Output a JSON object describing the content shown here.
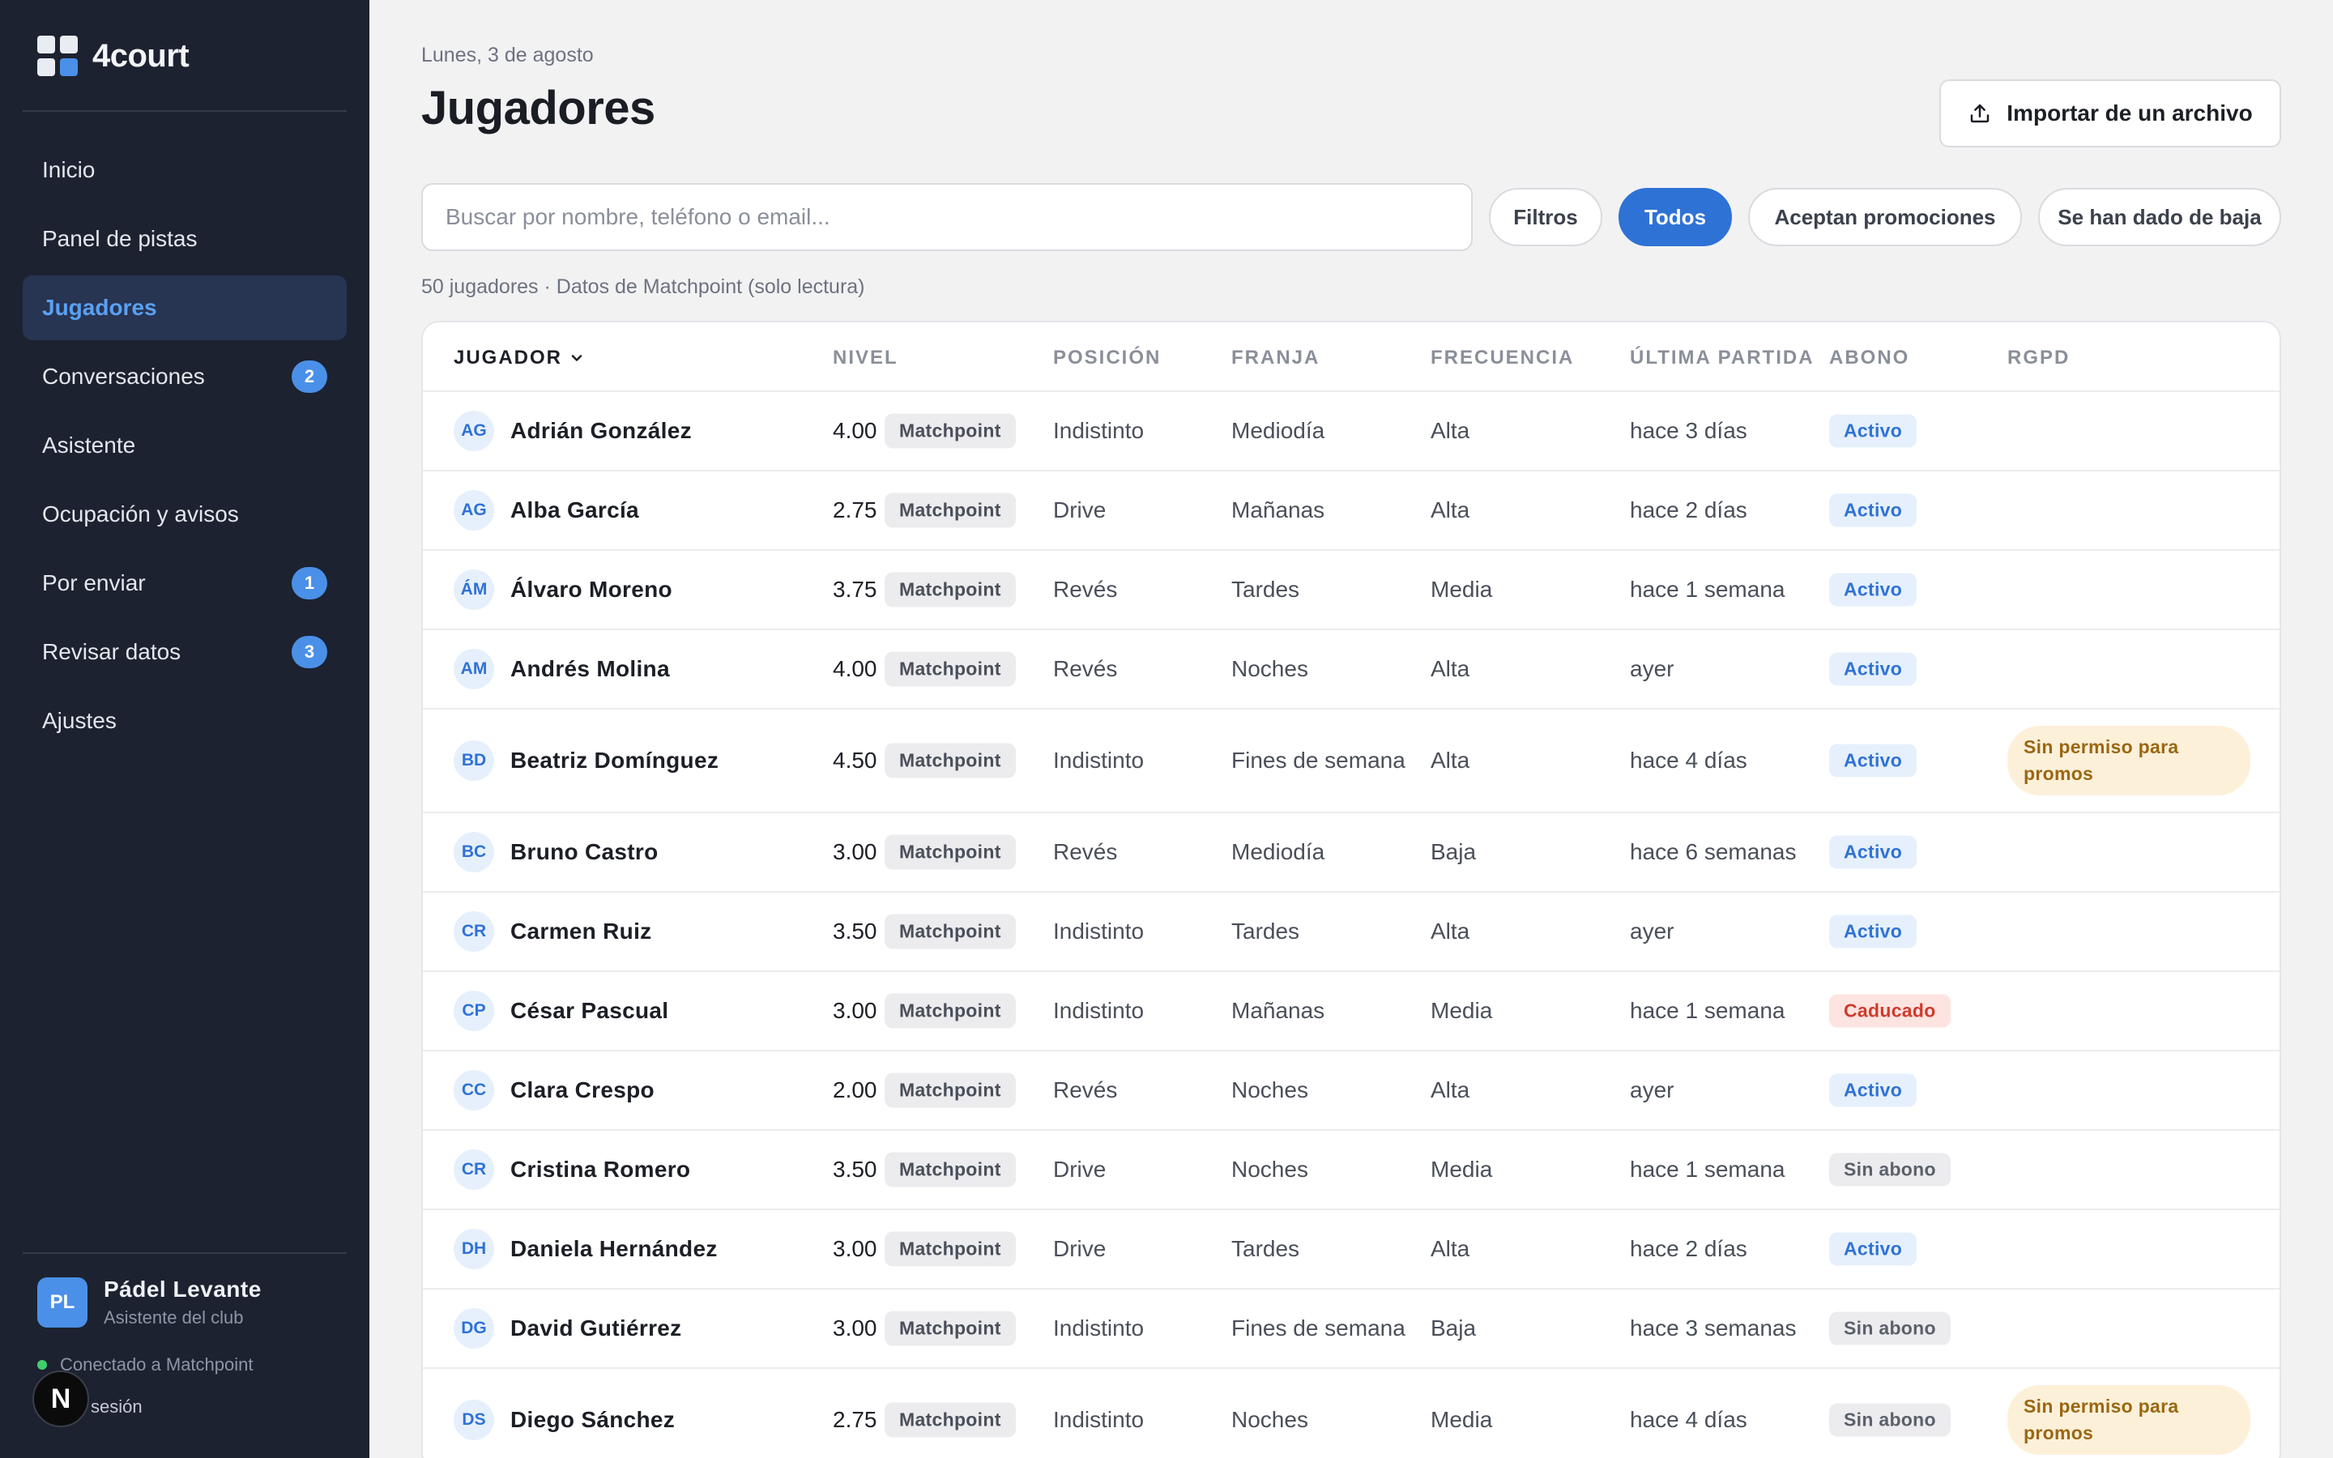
{
  "sidebar": {
    "brand": "4court",
    "nav": [
      {
        "label": "Inicio",
        "name": "inicio"
      },
      {
        "label": "Panel de pistas",
        "name": "panel-de-pistas"
      },
      {
        "label": "Jugadores",
        "name": "jugadores",
        "active": true
      },
      {
        "label": "Conversaciones",
        "name": "conversaciones",
        "badge": "2"
      },
      {
        "label": "Asistente",
        "name": "asistente"
      },
      {
        "label": "Ocupación y avisos",
        "name": "ocupacion-y-avisos"
      },
      {
        "label": "Por enviar",
        "name": "por-enviar",
        "badge": "1"
      },
      {
        "label": "Revisar datos",
        "name": "revisar-datos",
        "badge": "3"
      },
      {
        "label": "Ajustes",
        "name": "ajustes"
      }
    ],
    "club": {
      "initials": "PL",
      "name": "Pádel Levante",
      "role": "Asistente del club"
    },
    "connection": "Conectado a Matchpoint",
    "logout_fragment": "sesión",
    "n_badge": "N"
  },
  "header": {
    "date": "Lunes, 3 de agosto",
    "title": "Jugadores",
    "import_label": "Importar de un archivo"
  },
  "toolbar": {
    "search_placeholder": "Buscar por nombre, teléfono o email...",
    "filters_label": "Filtros",
    "segments": [
      "Todos",
      "Aceptan promociones",
      "Se han dado de baja"
    ],
    "active_segment": "Todos"
  },
  "summary": "50 jugadores · Datos de Matchpoint (solo lectura)",
  "table": {
    "columns": [
      "JUGADOR",
      "NIVEL",
      "POSICIÓN",
      "FRANJA",
      "FRECUENCIA",
      "ÚLTIMA PARTIDA",
      "ABONO",
      "RGPD"
    ],
    "sorted_column": "JUGADOR",
    "source_tag": "Matchpoint",
    "rows": [
      {
        "initials": "AG",
        "name": "Adrián González",
        "level": "4.00",
        "position": "Indistinto",
        "slot": "Mediodía",
        "frequency": "Alta",
        "last_match": "hace 3 días",
        "membership": "Activo",
        "status_kind": "activo",
        "rgpd": ""
      },
      {
        "initials": "AG",
        "name": "Alba García",
        "level": "2.75",
        "position": "Drive",
        "slot": "Mañanas",
        "frequency": "Alta",
        "last_match": "hace 2 días",
        "membership": "Activo",
        "status_kind": "activo",
        "rgpd": ""
      },
      {
        "initials": "ÁM",
        "name": "Álvaro Moreno",
        "level": "3.75",
        "position": "Revés",
        "slot": "Tardes",
        "frequency": "Media",
        "last_match": "hace 1 semana",
        "membership": "Activo",
        "status_kind": "activo",
        "rgpd": ""
      },
      {
        "initials": "AM",
        "name": "Andrés Molina",
        "level": "4.00",
        "position": "Revés",
        "slot": "Noches",
        "frequency": "Alta",
        "last_match": "ayer",
        "membership": "Activo",
        "status_kind": "activo",
        "rgpd": ""
      },
      {
        "initials": "BD",
        "name": "Beatriz Domínguez",
        "level": "4.50",
        "position": "Indistinto",
        "slot": "Fines de semana",
        "frequency": "Alta",
        "last_match": "hace 4 días",
        "membership": "Activo",
        "status_kind": "activo",
        "rgpd": "Sin permiso para promos"
      },
      {
        "initials": "BC",
        "name": "Bruno Castro",
        "level": "3.00",
        "position": "Revés",
        "slot": "Mediodía",
        "frequency": "Baja",
        "last_match": "hace 6 semanas",
        "membership": "Activo",
        "status_kind": "activo",
        "rgpd": ""
      },
      {
        "initials": "CR",
        "name": "Carmen Ruiz",
        "level": "3.50",
        "position": "Indistinto",
        "slot": "Tardes",
        "frequency": "Alta",
        "last_match": "ayer",
        "membership": "Activo",
        "status_kind": "activo",
        "rgpd": ""
      },
      {
        "initials": "CP",
        "name": "César Pascual",
        "level": "3.00",
        "position": "Indistinto",
        "slot": "Mañanas",
        "frequency": "Media",
        "last_match": "hace 1 semana",
        "membership": "Caducado",
        "status_kind": "caducado",
        "rgpd": ""
      },
      {
        "initials": "CC",
        "name": "Clara Crespo",
        "level": "2.00",
        "position": "Revés",
        "slot": "Noches",
        "frequency": "Alta",
        "last_match": "ayer",
        "membership": "Activo",
        "status_kind": "activo",
        "rgpd": ""
      },
      {
        "initials": "CR",
        "name": "Cristina Romero",
        "level": "3.50",
        "position": "Drive",
        "slot": "Noches",
        "frequency": "Media",
        "last_match": "hace 1 semana",
        "membership": "Sin abono",
        "status_kind": "sinabono",
        "rgpd": ""
      },
      {
        "initials": "DH",
        "name": "Daniela Hernández",
        "level": "3.00",
        "position": "Drive",
        "slot": "Tardes",
        "frequency": "Alta",
        "last_match": "hace 2 días",
        "membership": "Activo",
        "status_kind": "activo",
        "rgpd": ""
      },
      {
        "initials": "DG",
        "name": "David Gutiérrez",
        "level": "3.00",
        "position": "Indistinto",
        "slot": "Fines de semana",
        "frequency": "Baja",
        "last_match": "hace 3 semanas",
        "membership": "Sin abono",
        "status_kind": "sinabono",
        "rgpd": ""
      },
      {
        "initials": "DS",
        "name": "Diego Sánchez",
        "level": "2.75",
        "position": "Indistinto",
        "slot": "Noches",
        "frequency": "Media",
        "last_match": "hace 4 días",
        "membership": "Sin abono",
        "status_kind": "sinabono",
        "rgpd": "Sin permiso para promos"
      }
    ]
  },
  "colors": {
    "accent": "#2f72d6",
    "sidebar_bg": "#1c2230",
    "background": "#f2f2f3"
  },
  "icons": {
    "import": "upload-icon",
    "sort": "chevron-down-icon",
    "brand": "grid-logo-icon"
  }
}
